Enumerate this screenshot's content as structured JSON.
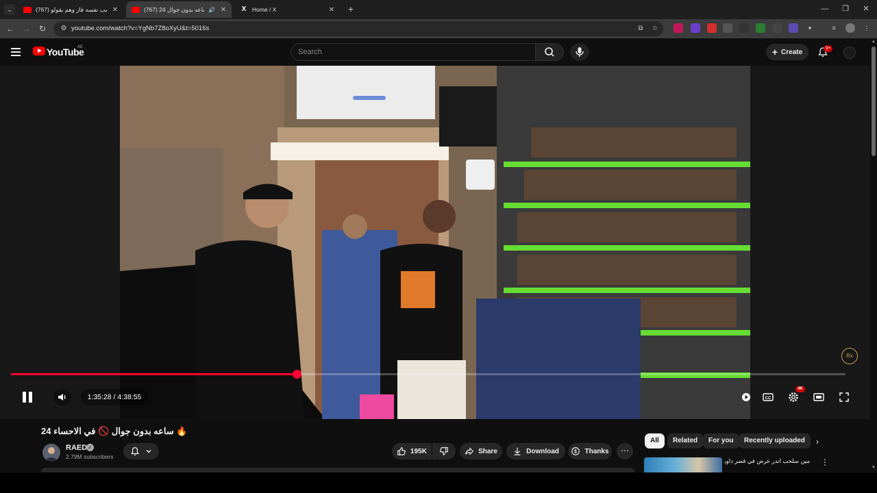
{
  "browser": {
    "tabs": [
      {
        "title": "(767) يحسب نفسه فاز وهم يقولو",
        "active": false
      },
      {
        "title": "(767) 24 ساعه بدون جوال",
        "active": true
      },
      {
        "title": "Home / X",
        "active": false
      }
    ],
    "new_tab": "+",
    "url": "youtube.com/watch?v=YgNb7Z8oXyU&t=5016s",
    "window_controls": [
      "—",
      "❐",
      "✕"
    ]
  },
  "masthead": {
    "logo_text": "YouTube",
    "country_code": "AE",
    "search_placeholder": "Search",
    "create_label": "Create",
    "notification_count": "9+"
  },
  "player": {
    "current_time": "1:35:28",
    "duration": "4:38:55",
    "time_display": "1:35:28 / 4:38:55",
    "progress_fraction": 0.3424,
    "quality_badge": "4K",
    "colors": {
      "progress": "#ff0033",
      "badge": "#cc0000"
    }
  },
  "video_info": {
    "title": "24 ساعه بدون جوال 🚫 في الاحساء 🔥",
    "channel_name": "RAED",
    "subscribers": "2.79M subscribers",
    "likes": "195K",
    "share_label": "Share",
    "download_label": "Download",
    "thanks_label": "Thanks"
  },
  "related": {
    "chips": [
      {
        "label": "All",
        "active": true
      },
      {
        "label": "Related",
        "active": false
      },
      {
        "label": "For you",
        "active": false
      },
      {
        "label": "Recently uploaded",
        "active": false
      }
    ],
    "first_item_title": "مين سلحب اندر عرض في قصر داور !!"
  }
}
